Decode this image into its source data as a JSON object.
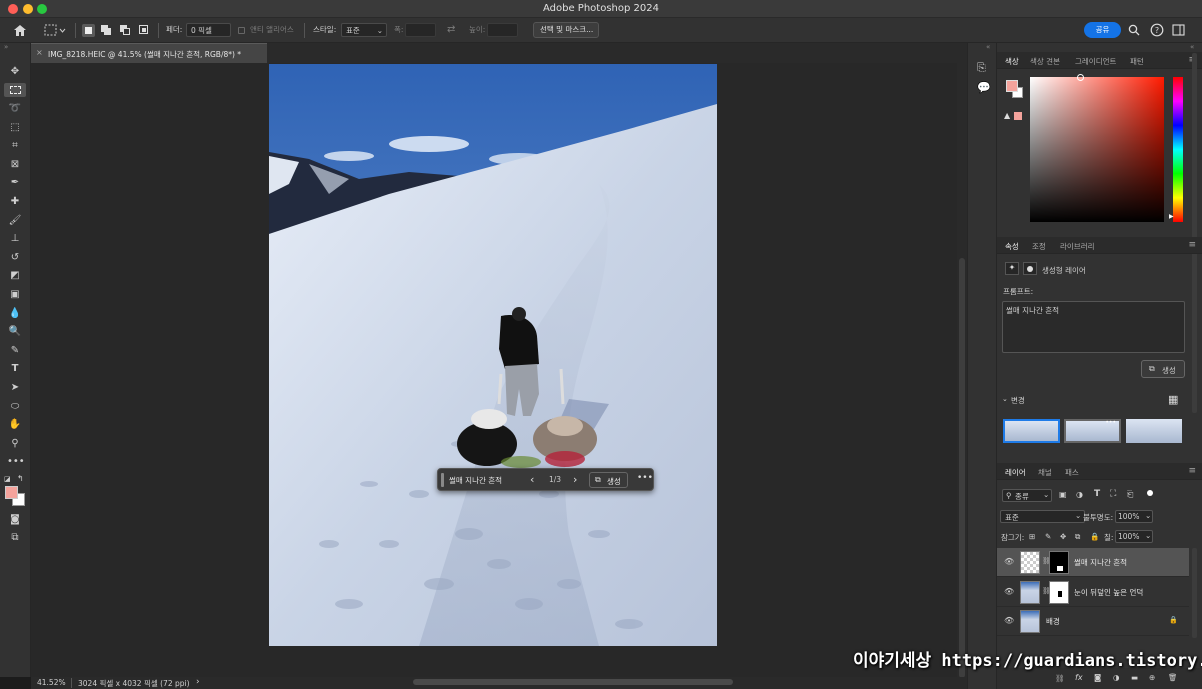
{
  "window": {
    "title": "Adobe Photoshop 2024"
  },
  "options_bar": {
    "feather_label": "페더:",
    "feather_value": "0 픽셀",
    "anti_alias_label": "앤티 앨리어스",
    "style_label": "스타일:",
    "style_value": "표준",
    "width_label": "폭:",
    "height_label": "높이:",
    "select_mask_button": "선택 및 마스크...",
    "share_button": "공유"
  },
  "document": {
    "tab_title": "IMG_8218.HEIC @ 41.5% (썰매 지나간 흔적, RGB/8*) *"
  },
  "contextual_bar": {
    "prompt": "썰매 지나간 흔적",
    "counter": "1/3",
    "generate_label": "생성"
  },
  "status_bar": {
    "zoom": "41.52%",
    "doc_info": "3024 픽셀 x 4032 픽셀 (72 ppi)"
  },
  "color_panel": {
    "tabs": [
      "색상",
      "색상 견본",
      "그레이디언트",
      "패턴"
    ],
    "foreground": "#f4a39c",
    "background": "#ffffff"
  },
  "properties_panel": {
    "tabs": [
      "속성",
      "조정",
      "라이브러리"
    ],
    "layer_type": "생성형 레이어",
    "prompt_label": "프롬프트:",
    "prompt_value": "썰매 지나간 흔적",
    "generate_button": "생성",
    "variations_label": "변경"
  },
  "layers_panel": {
    "tabs": [
      "레이어",
      "채널",
      "패스"
    ],
    "filter_label": "종류",
    "blend_mode": "표준",
    "opacity_label": "불투명도:",
    "opacity_value": "100%",
    "lock_label": "잠그기:",
    "fill_label": "칠:",
    "fill_value": "100%",
    "layers": [
      {
        "name": "썰매 지나간 흔적",
        "selected": true
      },
      {
        "name": "눈이 뒤덮인 높은 언덕",
        "selected": false
      },
      {
        "name": "배경",
        "selected": false
      }
    ]
  },
  "watermark": "이야기세상 https://guardians.tistory.com"
}
